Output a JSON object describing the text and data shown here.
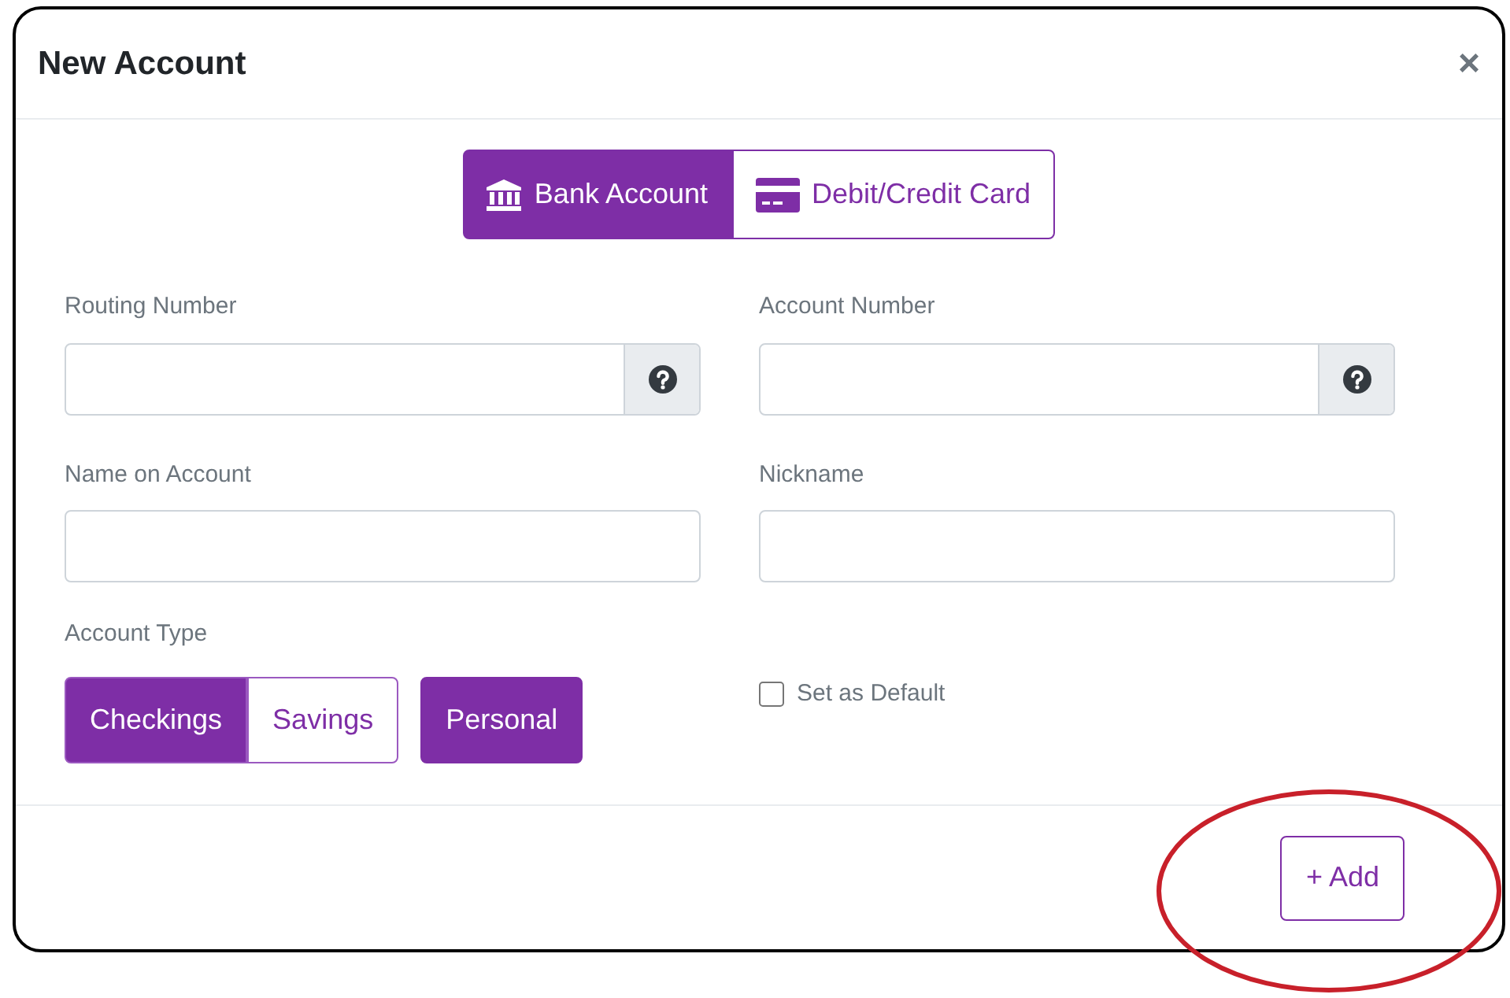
{
  "dialog": {
    "title": "New Account",
    "close": "×"
  },
  "tabs": [
    {
      "label": "Bank Account",
      "kind": "bank",
      "selected": true
    },
    {
      "label": "Debit/Credit Card",
      "kind": "card",
      "selected": false
    }
  ],
  "fields": [
    {
      "label": "Routing Number",
      "help": true
    },
    {
      "label": "Account Number",
      "help": true
    },
    {
      "label": "Name on Account",
      "help": false
    },
    {
      "label": "Nickname",
      "help": false
    }
  ],
  "account_type": {
    "label": "Account Type",
    "options": [
      {
        "label": "Checkings",
        "selected": true
      },
      {
        "label": "Savings",
        "selected": false
      }
    ],
    "holder": {
      "label": "Personal",
      "selected": true
    }
  },
  "default_checkbox": {
    "label": "Set as Default",
    "checked": false
  },
  "add_button": "+ Add"
}
